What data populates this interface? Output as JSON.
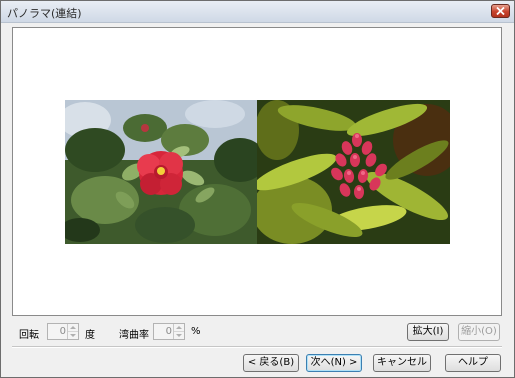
{
  "window": {
    "title": "パノラマ(連結)"
  },
  "preview": {
    "left_photo": "red camellia flower with green leaves",
    "right_photo": "red flower buds with green leaves"
  },
  "controls": {
    "rotation_label": "回転",
    "rotation_value": "0",
    "rotation_unit": "度",
    "curvature_label": "湾曲率",
    "curvature_value": "0",
    "curvature_unit": "%",
    "zoom_in_label": "拡大(I)",
    "zoom_out_label": "縮小(O)"
  },
  "footer": {
    "back_label": "< 戻る(B)",
    "next_label": "次へ(N) >",
    "cancel_label": "キャンセル",
    "help_label": "ヘルプ"
  }
}
